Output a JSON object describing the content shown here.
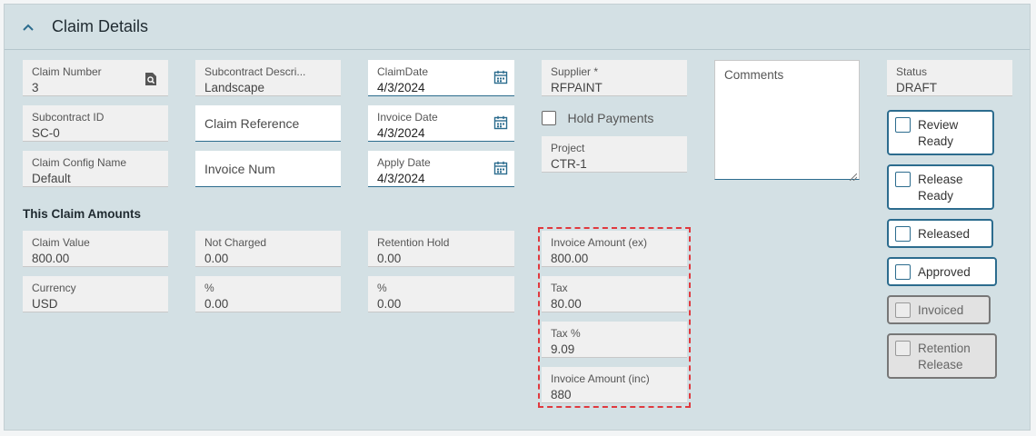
{
  "header": {
    "title": "Claim Details"
  },
  "fields": {
    "claim_number": {
      "label": "Claim Number",
      "value": "3"
    },
    "subcontract_description": {
      "label": "Subcontract Descri...",
      "value": "Landscape"
    },
    "claim_date": {
      "label": "ClaimDate",
      "value": "4/3/2024"
    },
    "supplier": {
      "label": "Supplier *",
      "value": "RFPAINT"
    },
    "status": {
      "label": "Status",
      "value": "DRAFT"
    },
    "subcontract_id": {
      "label": "Subcontract ID",
      "value": "SC-0"
    },
    "claim_reference": {
      "placeholder": "Claim Reference"
    },
    "invoice_date": {
      "label": "Invoice Date",
      "value": "4/3/2024"
    },
    "claim_config_name": {
      "label": "Claim Config Name",
      "value": "Default"
    },
    "invoice_num": {
      "placeholder": "Invoice Num"
    },
    "apply_date": {
      "label": "Apply Date",
      "value": "4/3/2024"
    },
    "project": {
      "label": "Project",
      "value": "CTR-1"
    }
  },
  "hold_payments": {
    "label": "Hold Payments"
  },
  "comments": {
    "placeholder": "Comments"
  },
  "amounts": {
    "section_title": "This Claim Amounts",
    "claim_value": {
      "label": "Claim Value",
      "value": "800.00"
    },
    "not_charged": {
      "label": "Not Charged",
      "value": "0.00"
    },
    "retention_hold": {
      "label": "Retention Hold",
      "value": "0.00"
    },
    "currency": {
      "label": "Currency",
      "value": "USD"
    },
    "not_charged_pct": {
      "label": "%",
      "value": "0.00"
    },
    "retention_hold_pct": {
      "label": "%",
      "value": "0.00"
    },
    "invoice_amount_ex": {
      "label": "Invoice Amount (ex)",
      "value": "800.00"
    },
    "tax": {
      "label": "Tax",
      "value": "80.00"
    },
    "tax_pct": {
      "label": "Tax %",
      "value": "9.09"
    },
    "invoice_amount_inc": {
      "label": "Invoice Amount (inc)",
      "value": "880"
    }
  },
  "actions": {
    "review_ready": {
      "line1": "Review",
      "line2": "Ready"
    },
    "release_ready": {
      "line1": "Release",
      "line2": "Ready"
    },
    "released": {
      "label": "Released"
    },
    "approved": {
      "label": "Approved"
    },
    "invoiced": {
      "label": "Invoiced"
    },
    "retention_release": {
      "line1": "Retention",
      "line2": "Release"
    }
  },
  "colors": {
    "accent": "#2c6c8e",
    "highlight": "#e0393e",
    "panel": "#d3e0e4"
  }
}
